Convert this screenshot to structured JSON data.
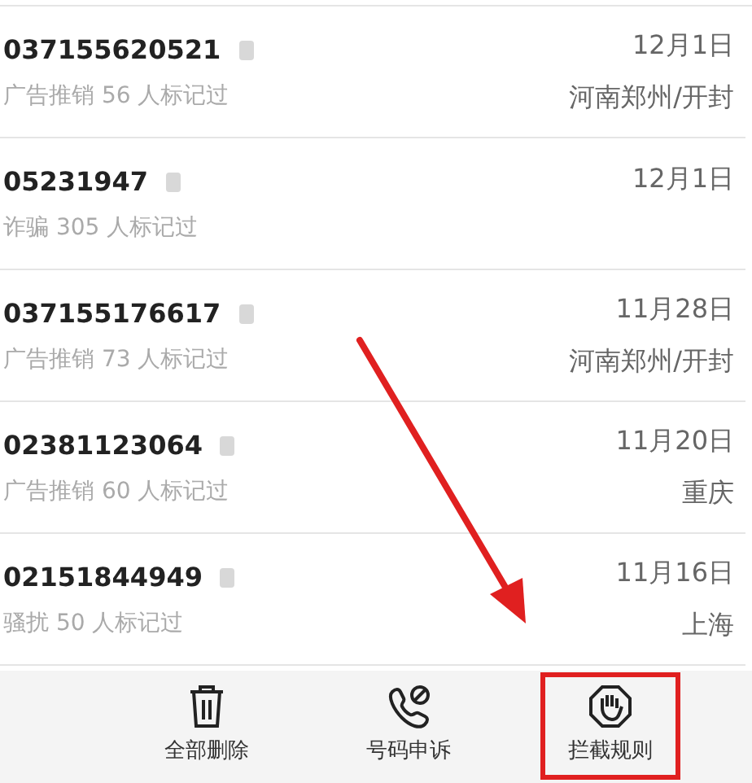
{
  "calls": [
    {
      "number": "037155620521",
      "tag": "广告推销 56 人标记过",
      "date": "12月1日",
      "location": "河南郑州/开封"
    },
    {
      "number": "05231947",
      "tag": "诈骗 305 人标记过",
      "date": "12月1日"
    },
    {
      "number": "037155176617",
      "tag": "广告推销 73 人标记过",
      "date": "11月28日",
      "location": "河南郑州/开封"
    },
    {
      "number": "02381123064",
      "tag": "广告推销 60 人标记过",
      "date": "11月20日",
      "location": "重庆"
    },
    {
      "number": "02151844949",
      "tag": "骚扰 50 人标记过",
      "date": "11月16日",
      "location": "上海"
    }
  ],
  "toolbar": [
    {
      "kind": "trash",
      "label": "全部删除",
      "highlighted": false
    },
    {
      "kind": "phone",
      "label": "号码申诉",
      "highlighted": false
    },
    {
      "kind": "hand",
      "label": "拦截规则",
      "highlighted": true
    }
  ]
}
